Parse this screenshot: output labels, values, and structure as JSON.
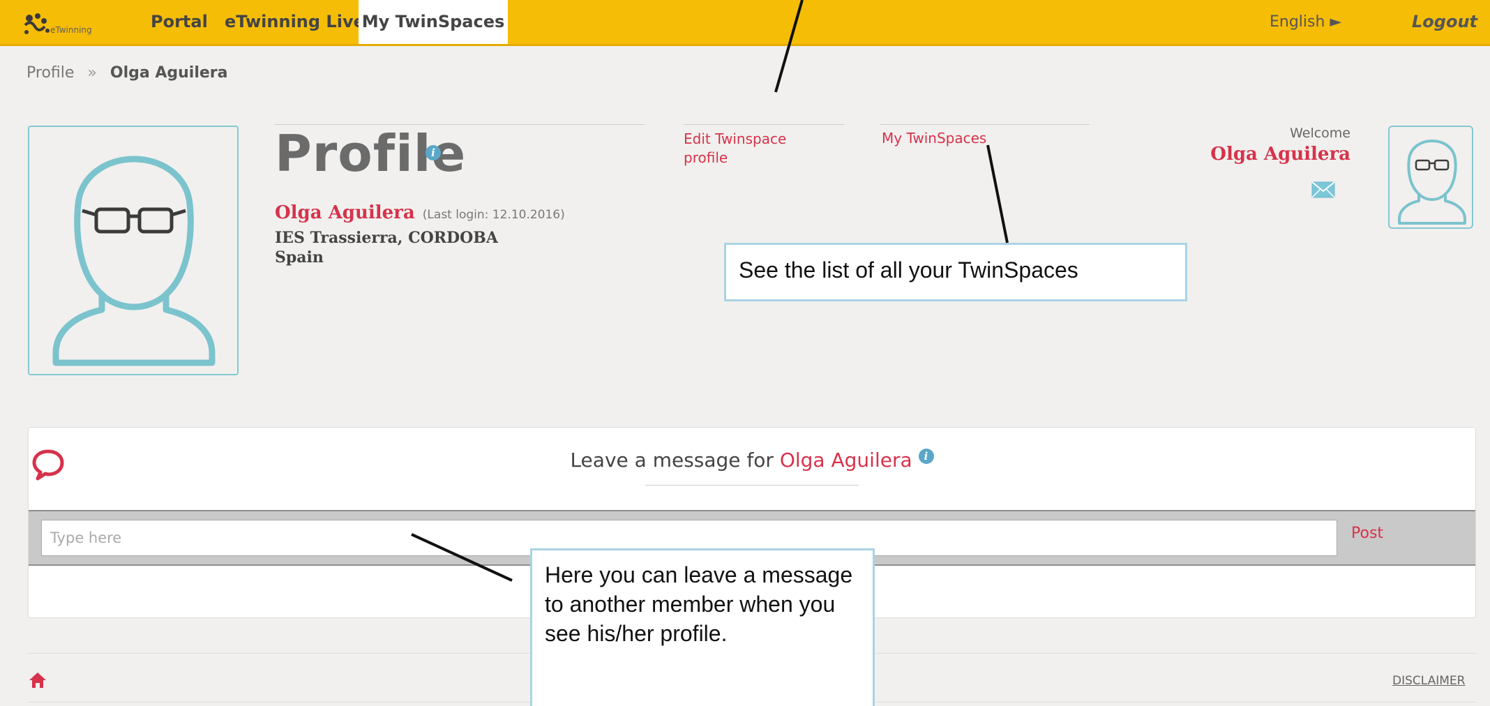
{
  "topbar": {
    "logo_text": "eTwinning",
    "nav": {
      "portal": "Portal",
      "live": "eTwinning Live",
      "spaces": "My TwinSpaces"
    },
    "language": "English ►",
    "logout": "Logout"
  },
  "breadcrumb": {
    "root": "Profile",
    "separator": "»",
    "current": "Olga Aguilera"
  },
  "profile": {
    "title": "Profile",
    "info_glyph": "i",
    "name": "Olga Aguilera",
    "last_login": "(Last login: 12.10.2016)",
    "school": "IES Trassierra, CORDOBA",
    "country": "Spain",
    "edit_link": "Edit Twinspace profile",
    "spaces_link": "My TwinSpaces"
  },
  "welcome": {
    "label": "Welcome",
    "name": "Olga Aguilera"
  },
  "message": {
    "title_prefix": "Leave a message for",
    "title_name": "Olga Aguilera",
    "placeholder": "Type here",
    "post_label": "Post"
  },
  "footer": {
    "disclaimer": "DISCLAIMER"
  },
  "callouts": {
    "spaces_tip": "See the list of all your TwinSpaces",
    "message_tip": "Here you can leave a message to another member when you see his/her profile."
  },
  "colors": {
    "topbar": "#f6bd06",
    "accent_red": "#d7324b",
    "avatar_blue": "#84c8d1",
    "callout_border": "#a9d3e4",
    "info_blue": "#5aa7c9"
  }
}
